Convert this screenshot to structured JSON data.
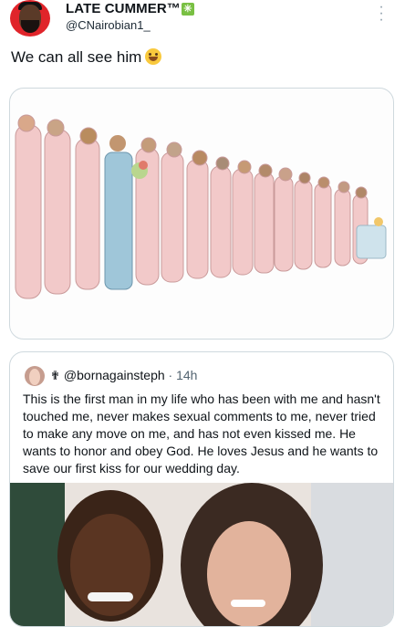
{
  "author": {
    "display_name": "LATE CUMMER™",
    "badge_icon": "sparkle-emoji-icon",
    "handle": "@CNairobian1_"
  },
  "tweet": {
    "text": "We can all see him",
    "emoji": "grinning-sweat-emoji-icon"
  },
  "media": {
    "description_icon": "cartoon-illustration"
  },
  "quoted_tweet": {
    "icon": "cross-icon",
    "handle": "@bornagainsteph",
    "separator": "·",
    "time": "14h",
    "text": "This is the first man in my life who has been with me and hasn't touched me, never makes sexual comments to me, never tried to make any move on me,  and has not even kissed me. He wants to honor and obey God. He loves Jesus and he wants to save our first kiss for our wedding day."
  },
  "colors": {
    "accent_avatar": "#e0242a",
    "border": "#cfd9de",
    "muted_text": "#536471"
  }
}
